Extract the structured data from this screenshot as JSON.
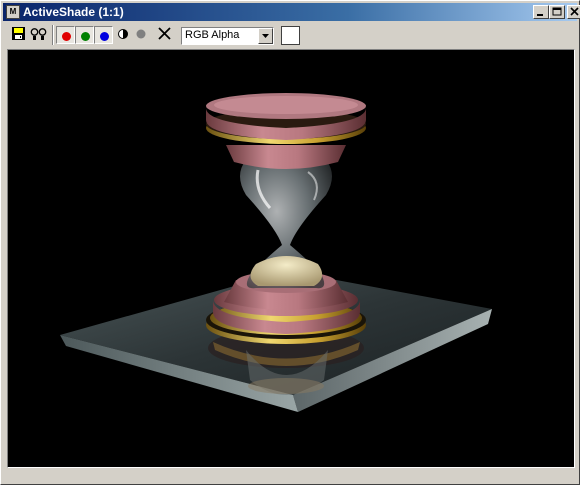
{
  "window": {
    "title": "ActiveShade (1:1)",
    "title_icon_text": "M"
  },
  "toolbar": {
    "save_icon": "floppy-disk-icon",
    "clone_icon": "clone-window-icon",
    "channels": [
      {
        "name": "red-channel",
        "color": "#e00000"
      },
      {
        "name": "green-channel",
        "color": "#008000"
      },
      {
        "name": "blue-channel",
        "color": "#0000e0"
      }
    ],
    "mono_icon": "monochrome-icon",
    "alpha_icon": "alpha-dot-icon",
    "clear_icon": "clear-x-icon",
    "channel_select": {
      "value": "RGB Alpha"
    },
    "swatch_color": "#ffffff"
  },
  "viewport": {
    "background": "#000000",
    "scene": "hourglass-render"
  },
  "colors": {
    "titlebar_start": "#0a246a",
    "titlebar_end": "#a6caf0",
    "chrome": "#d4d0c8"
  }
}
